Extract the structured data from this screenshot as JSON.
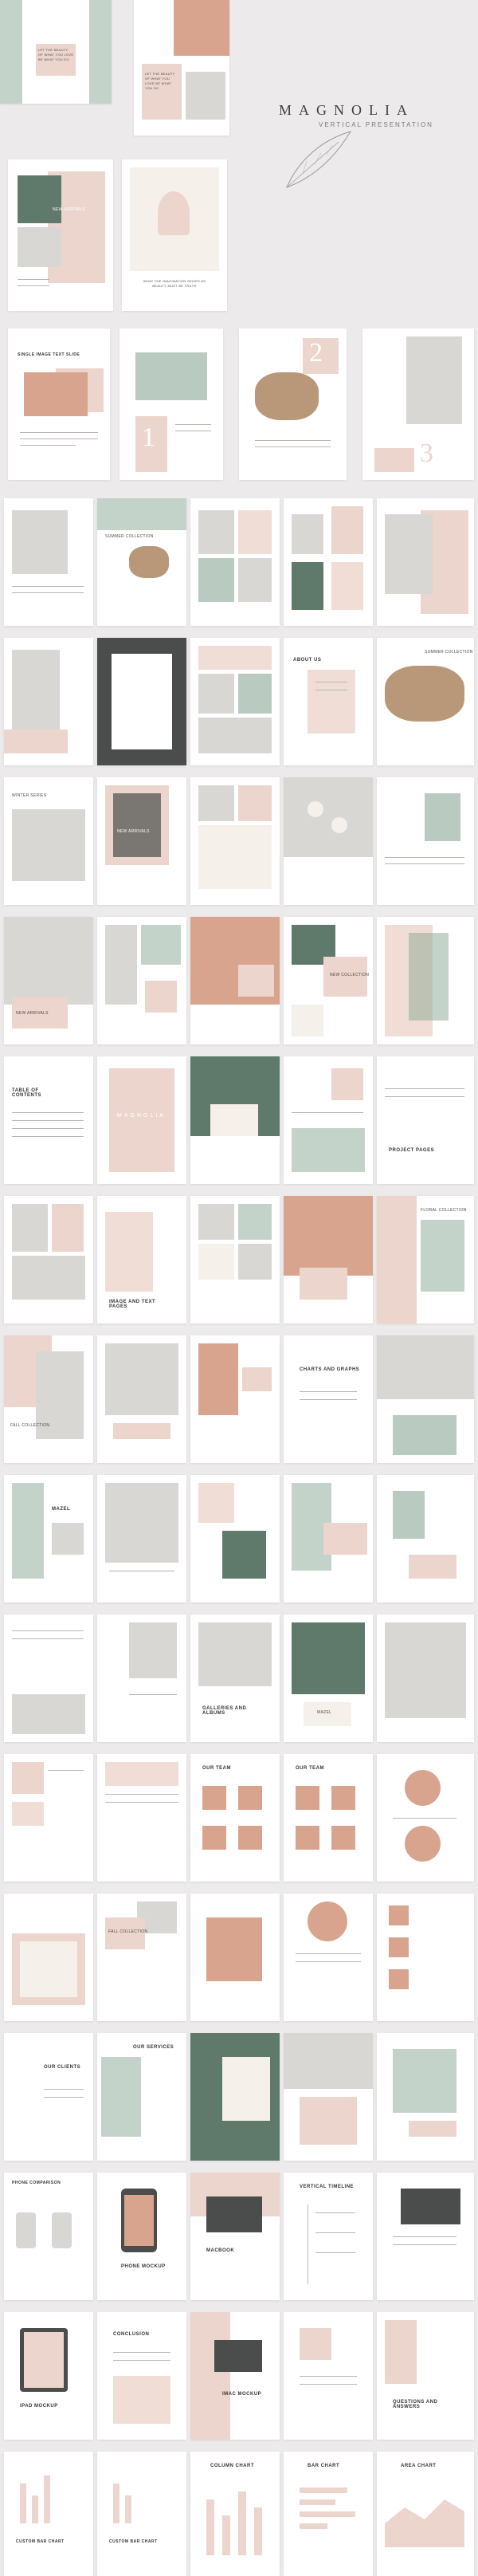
{
  "brand": {
    "name": "MAGNOLIA",
    "subtitle": "VERTICAL PRESENTATION"
  },
  "slides": {
    "s1": "LET THE BEAUTY OF WHAT YOU LOVE BE WHAT YOU DO",
    "s2": "LET THE BEAUTY OF WHAT YOU LOVE BE WHAT YOU DO",
    "new_arrivals": "NEW ARRIVALS",
    "quote": "WHAT THE IMAGINATION SEIZES AS BEAUTY MUST BE TRUTH",
    "single_image": "SINGLE IMAGE TEXT SLIDE",
    "n1": "1",
    "n2": "2",
    "n3": "3",
    "summer": "SUMMER COLLECTION",
    "about": "ABOUT US",
    "winter": "WINTER SERIES",
    "new_collection": "NEW COLLECTION",
    "fall": "FALL COLLECTION",
    "toc": "TABLE OF CONTENTS",
    "magnolia_cover": "MAGNOLIA",
    "project_pages": "PROJECT PAGES",
    "image_text": "IMAGE AND TEXT PAGES",
    "floral": "FLORAL COLLECTION",
    "charts": "CHARTS AND GRAPHS",
    "mazel": "MAZEL",
    "galleries": "GALLERIES AND ALBUMS",
    "our_team": "OUR TEAM",
    "our_clients": "OUR CLIENTS",
    "our_services": "OUR SERVICES",
    "phone": "PHONE COMPARISON",
    "phone_mockup": "PHONE MOCKUP",
    "macbook": "MACBOOK",
    "timeline": "VERTICAL TIMELINE",
    "conclusion": "CONCLUSION",
    "ipad": "IPAD MOCKUP",
    "imac": "IMAC MOCKUP",
    "qa": "QUESTIONS AND ANSWERS",
    "column_chart": "COLUMN CHART",
    "bar_chart": "BAR CHART",
    "area_chart": "AREA CHART",
    "custom_bar": "CUSTOM BAR CHART"
  }
}
